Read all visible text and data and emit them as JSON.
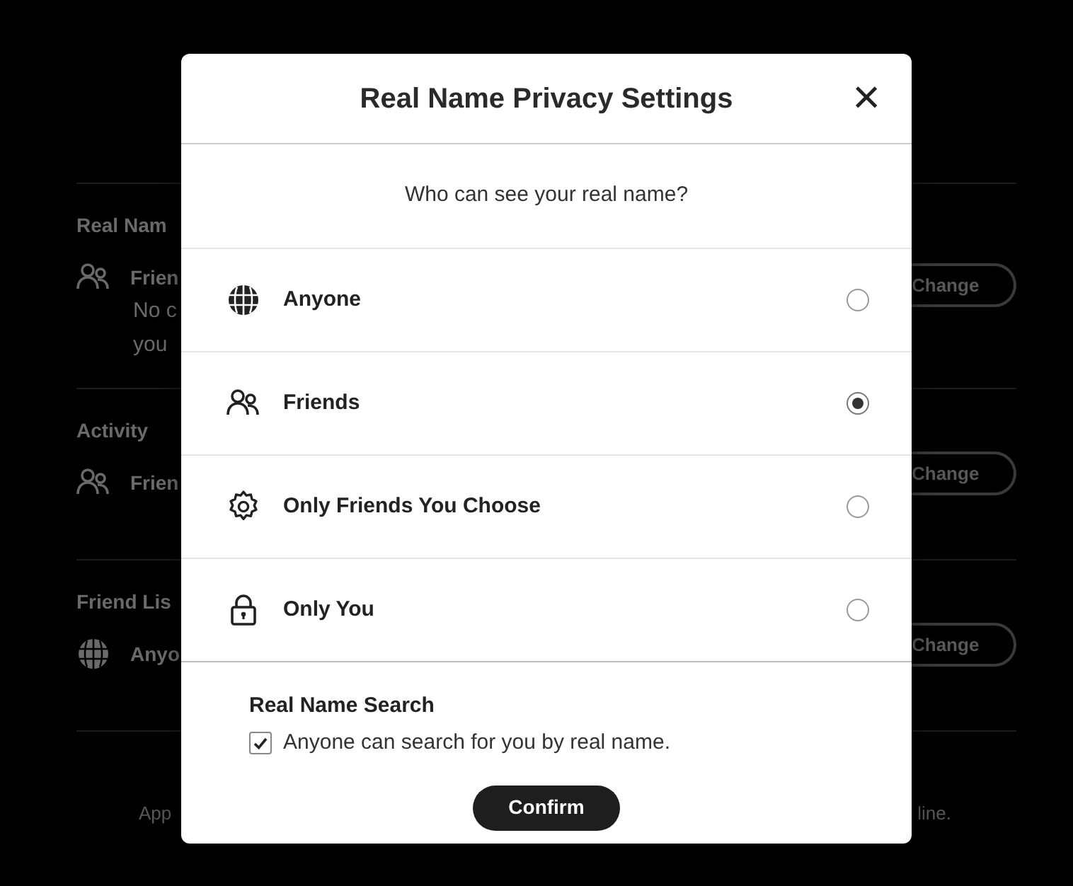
{
  "background": {
    "sections": [
      {
        "heading": "Real Nam",
        "value": "Frien",
        "kind": "friends",
        "description": [
          "No c",
          "you"
        ],
        "button": "Change"
      },
      {
        "heading": "Activity",
        "value": "Frien",
        "kind": "friends",
        "button": "Change"
      },
      {
        "heading": "Friend Lis",
        "value": "Anyo",
        "kind": "globe",
        "button": "Change"
      }
    ],
    "footer": [
      "App",
      "line."
    ]
  },
  "modal": {
    "title": "Real Name Privacy Settings",
    "close": "×",
    "question": "Who can see your real name?",
    "options": [
      {
        "label": "Anyone",
        "kind": "globe",
        "selected": false
      },
      {
        "label": "Friends",
        "kind": "friends",
        "selected": true
      },
      {
        "label": "Only Friends You Choose",
        "kind": "gear",
        "selected": false
      },
      {
        "label": "Only You",
        "kind": "lock",
        "selected": false
      }
    ],
    "search": {
      "heading": "Real Name Search",
      "label": "Anyone can search for you by real name.",
      "checked": true
    },
    "confirm": "Confirm"
  }
}
